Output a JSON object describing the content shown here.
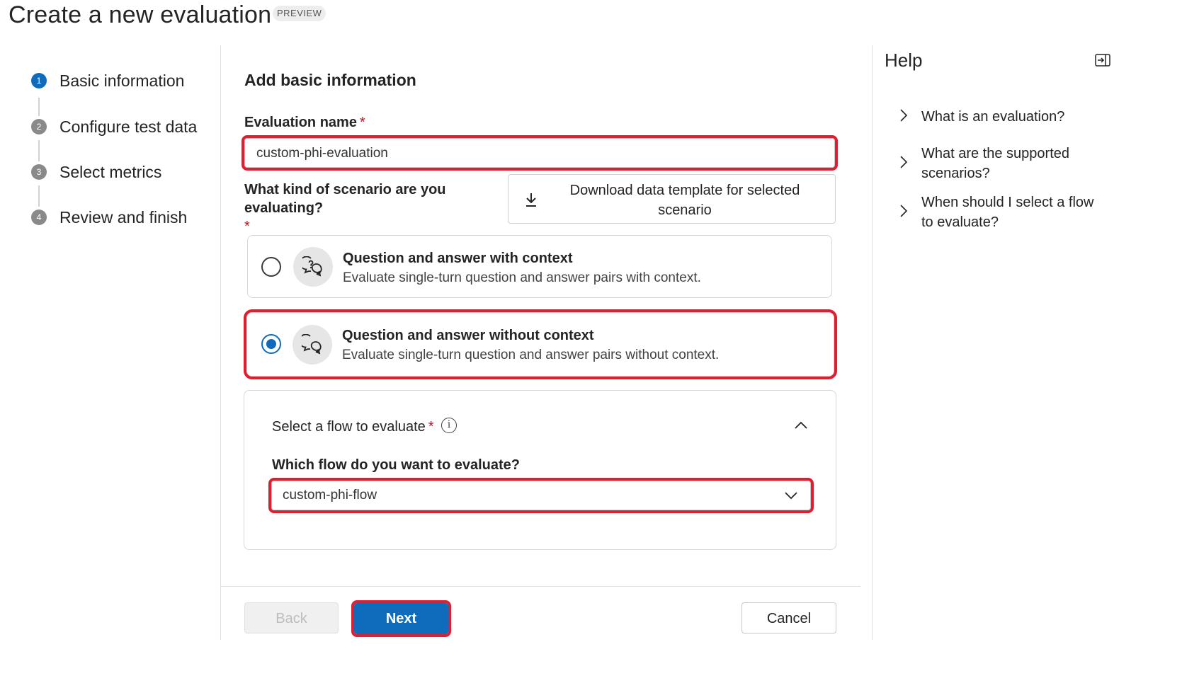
{
  "header": {
    "title": "Create a new evaluation",
    "badge": "PREVIEW"
  },
  "stepper": {
    "steps": [
      {
        "number": "1",
        "label": "Basic information",
        "state": "active"
      },
      {
        "number": "2",
        "label": "Configure test data",
        "state": "pending"
      },
      {
        "number": "3",
        "label": "Select metrics",
        "state": "pending"
      },
      {
        "number": "4",
        "label": "Review and finish",
        "state": "pending"
      }
    ]
  },
  "form": {
    "section_title": "Add basic information",
    "evaluation_name": {
      "label": "Evaluation name",
      "required_marker": "*",
      "value": "custom-phi-evaluation"
    },
    "scenario": {
      "label": "What kind of scenario are you evaluating?",
      "required_marker": "*",
      "download_button_label": "Download data template for selected scenario",
      "options": [
        {
          "title": "Question and answer with context",
          "description": "Evaluate single-turn question and answer pairs with context.",
          "selected": false,
          "icon": "chat-question-icon"
        },
        {
          "title": "Question and answer without context",
          "description": "Evaluate single-turn question and answer pairs without context.",
          "selected": true,
          "icon": "chat-bubbles-icon"
        }
      ]
    },
    "flow": {
      "title": "Select a flow to evaluate",
      "required_marker": "*",
      "info_glyph": "i",
      "question": "Which flow do you want to evaluate?",
      "selected_value": "custom-phi-flow"
    }
  },
  "footer": {
    "back_label": "Back",
    "next_label": "Next",
    "cancel_label": "Cancel"
  },
  "help": {
    "title": "Help",
    "items": [
      {
        "label": "What is an evaluation?"
      },
      {
        "label": "What are the supported scenarios?"
      },
      {
        "label": "When should I select a flow to evaluate?"
      }
    ]
  },
  "colors": {
    "accent": "#0f6cbd",
    "highlight": "#e01e2f",
    "required": "#c50f1f"
  }
}
